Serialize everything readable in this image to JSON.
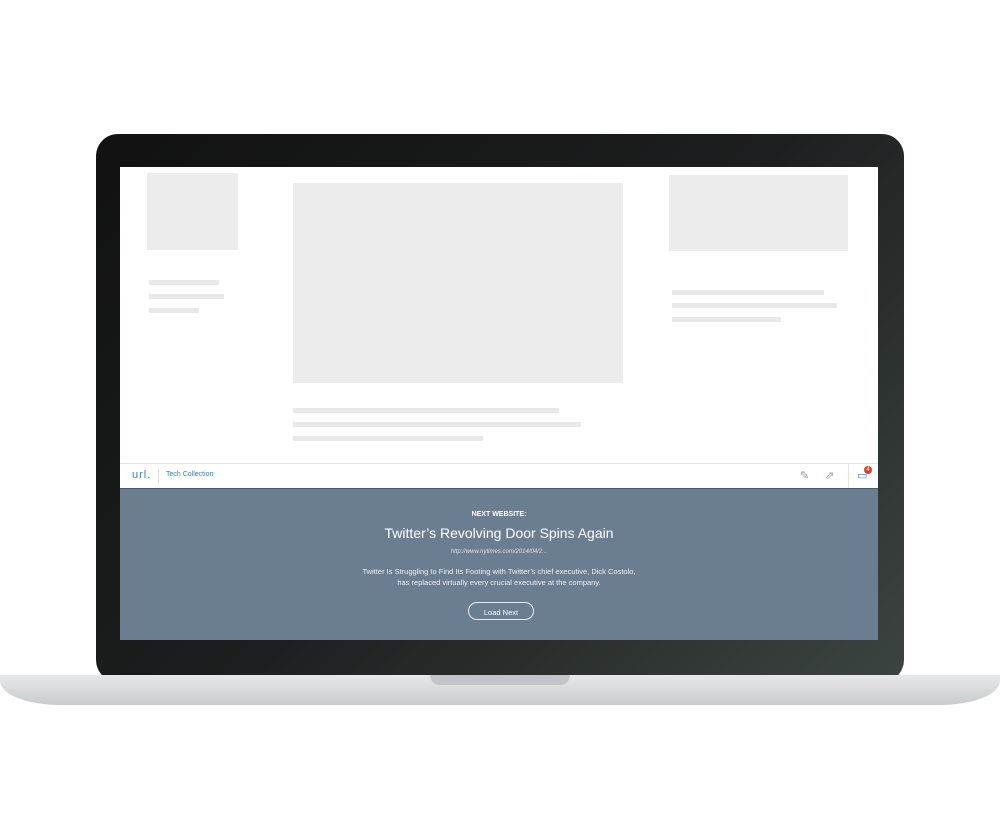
{
  "toolbar": {
    "logo": "url.",
    "collection": "Tech Collection",
    "badge_count": "4",
    "icons": [
      "pencil-icon",
      "share-icon",
      "collection-icon"
    ]
  },
  "next": {
    "label": "NEXT WEBSITE:",
    "title": "Twitter’s Revolving Door Spins Again",
    "url": "http://www.nytimes.com/2014/04/2...",
    "description": "Twitter Is Struggling to Find Its Footing with  Twitter’s chief executive, Dick Costolo, has replaced virtually every crucial executive at the company.",
    "button": "Load Next"
  },
  "colors": {
    "panel": "#6b7d90",
    "accent": "#3b7fb0",
    "badge": "#e0402f"
  }
}
